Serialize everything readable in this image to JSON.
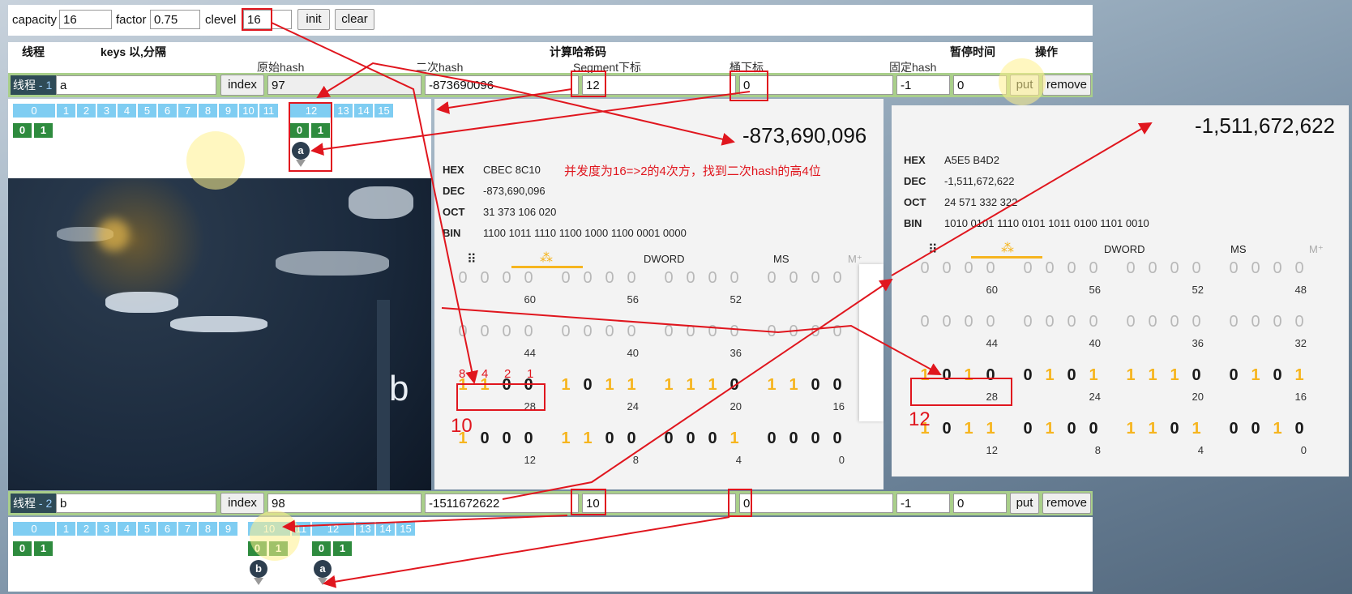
{
  "controls": {
    "capacity_label": "capacity",
    "capacity_value": "16",
    "factor_label": "factor",
    "factor_value": "0.75",
    "clevel_label": "clevel",
    "clevel_value": "16",
    "init_label": "init",
    "clear_label": "clear"
  },
  "header": {
    "thread": "线程",
    "keys": "keys 以,分隔",
    "compute": "计算哈希码",
    "pause": "暂停时间",
    "ops": "操作",
    "raw_hash": "原始hash",
    "second_hash": "二次hash",
    "segment_index": "Segment下标",
    "bucket_index": "桶下标",
    "fixed_hash": "固定hash"
  },
  "rows": [
    {
      "thread_prefix": "线程",
      "thread_num": " - 1",
      "key": "a",
      "index_label": "index",
      "raw_hash": "97",
      "second_hash": "-873690096",
      "segment": "12",
      "bucket": "0",
      "fixed": "-1",
      "pause": "0",
      "put_label": "put",
      "remove_label": "remove"
    },
    {
      "thread_prefix": "线程",
      "thread_num": " - 2",
      "key": "b",
      "index_label": "index",
      "raw_hash": "98",
      "second_hash": "-1511672622",
      "segment": "10",
      "bucket": "0",
      "fixed": "-1",
      "pause": "0",
      "put_label": "put",
      "remove_label": "remove"
    }
  ],
  "segments": [
    "0",
    "1",
    "2",
    "3",
    "4",
    "5",
    "6",
    "7",
    "8",
    "9",
    "10",
    "11",
    "12",
    "13",
    "14",
    "15"
  ],
  "buckets": [
    "0",
    "1"
  ],
  "nodes": {
    "a": "a",
    "b": "b"
  },
  "calc1": {
    "big": "-873,690,096",
    "hex_k": "HEX",
    "hex_v": "CBEC 8C10",
    "dec_k": "DEC",
    "dec_v": "-873,690,096",
    "oct_k": "OCT",
    "oct_v": "31 373 106 020",
    "bin_k": "BIN",
    "bin_v": "1100 1011 1110 1100 1000 1100 0001 0000",
    "tab_dword": "DWORD",
    "tab_ms": "MS",
    "tab_more": "M⁺",
    "note": "并发度为16=>2的4次方，找到二次hash的高4位",
    "rowA": "0000000000000000",
    "rowA_pos": [
      "60",
      "56",
      "52"
    ],
    "rowB": "0000000000000000",
    "rowB_pos": [
      "44",
      "40",
      "36"
    ],
    "rowC": "1100101111101100",
    "rowC_pos": [
      "28",
      "24",
      "20",
      "16"
    ],
    "rowD": "1000110000010000",
    "rowD_pos": [
      "12",
      "8",
      "4",
      "0"
    ],
    "weights": [
      "8",
      "4",
      "2",
      "1"
    ],
    "result": "10"
  },
  "calc2": {
    "big": "-1,511,672,622",
    "hex_k": "HEX",
    "hex_v": "A5E5 B4D2",
    "dec_k": "DEC",
    "dec_v": "-1,511,672,622",
    "oct_k": "OCT",
    "oct_v": "24 571 332 322",
    "bin_k": "BIN",
    "bin_v": "1010 0101 1110 0101 1011 0100 1101 0010",
    "tab_dword": "DWORD",
    "tab_ms": "MS",
    "tab_more": "M⁺",
    "rowA": "0000000000000000",
    "rowA_pos": [
      "60",
      "56",
      "52",
      "48"
    ],
    "rowB": "0000000000000000",
    "rowB_pos": [
      "44",
      "40",
      "36",
      "32"
    ],
    "rowC": "1010010111100101",
    "rowC_pos": [
      "28",
      "24",
      "20",
      "16"
    ],
    "rowD": "1011010011010010",
    "rowD_pos": [
      "12",
      "8",
      "4",
      "0"
    ],
    "result": "12"
  },
  "colors": {
    "accent_red": "#e0161e",
    "segment_blue": "#7fcdf2",
    "bucket_green": "#2e8b3e",
    "row_green": "#a9cf8a"
  }
}
